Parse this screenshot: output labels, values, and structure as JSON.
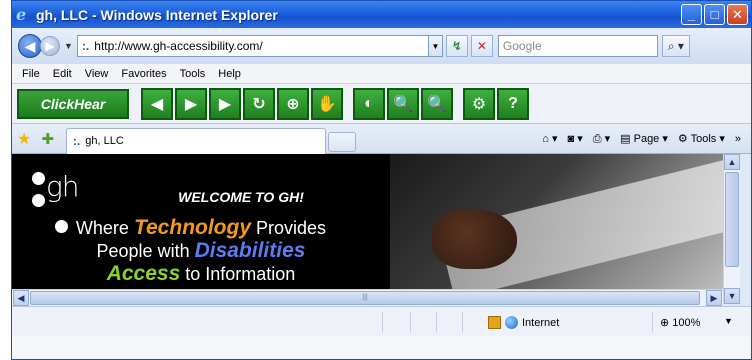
{
  "window": {
    "title": "gh, LLC - Windows Internet Explorer",
    "buttons": {
      "minimize": "_",
      "maximize": "□",
      "close": "✕"
    }
  },
  "address": {
    "url": "http://www.gh-accessibility.com/",
    "search_placeholder": "Google"
  },
  "menu": [
    "File",
    "Edit",
    "View",
    "Favorites",
    "Tools",
    "Help"
  ],
  "toolbar": {
    "clickhear_label": "ClickHear",
    "buttons": [
      {
        "icon": "prev-icon",
        "glyph": "◀"
      },
      {
        "icon": "play-icon",
        "glyph": "▶"
      },
      {
        "icon": "next-icon",
        "glyph": "▶"
      },
      {
        "icon": "refresh-icon",
        "glyph": "↻"
      },
      {
        "icon": "target-icon",
        "glyph": "⊕"
      },
      {
        "icon": "hand-icon",
        "glyph": "✋"
      },
      {
        "icon": "contrast-icon",
        "glyph": "◐"
      },
      {
        "icon": "zoom-in-icon",
        "glyph": "🔍"
      },
      {
        "icon": "zoom-out-icon",
        "glyph": "🔍"
      },
      {
        "icon": "settings-icon",
        "glyph": "⚙"
      },
      {
        "icon": "help-icon",
        "glyph": "?"
      }
    ]
  },
  "tabs": {
    "active_tab": "gh, LLC",
    "commands": {
      "page": "Page",
      "tools": "Tools"
    }
  },
  "page": {
    "logo_text": "gh",
    "welcome": "WELCOME TO GH!",
    "line1_pre": "Where ",
    "line1_emph": "Technology",
    "line1_post": " Provides",
    "line2_pre": "People with ",
    "line2_emph": "Disabilities",
    "line3_emph": "Access",
    "line3_post": " to Information"
  },
  "status": {
    "zone": "Internet",
    "zoom": "100%"
  }
}
